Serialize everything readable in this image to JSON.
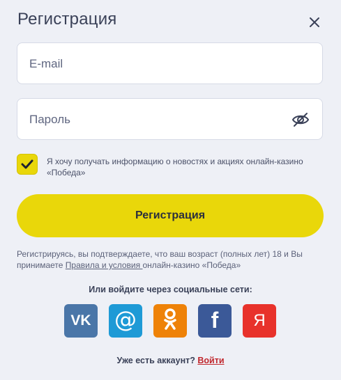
{
  "header": {
    "title": "Регистрация",
    "close_icon": "close-icon"
  },
  "form": {
    "email": {
      "placeholder": "E-mail",
      "value": ""
    },
    "password": {
      "placeholder": "Пароль",
      "value": "",
      "toggle_icon": "eye-off-icon"
    },
    "consent": {
      "checked": true,
      "text": "Я хочу получать информацию о новостях и акциях онлайн-казино «Победа»"
    },
    "submit_label": "Регистрация"
  },
  "legal": {
    "text_before": "Регистрируясь, вы подтверждаете, что ваш возраст (полных лет) 18 и Вы принимаете ",
    "link": "Правила и условия ",
    "text_after": "онлайн-казино «Победа»"
  },
  "social": {
    "title": "Или войдите через социальные сети:",
    "providers": [
      {
        "name": "vk",
        "icon": "vk-icon",
        "label": "VK",
        "color": "#4a76a8"
      },
      {
        "name": "mailru",
        "icon": "at-icon",
        "label": "@",
        "color": "#1e9ad6"
      },
      {
        "name": "odnoklassniki",
        "icon": "ok-icon",
        "color": "#ee8208"
      },
      {
        "name": "facebook",
        "icon": "facebook-icon",
        "label": "f",
        "color": "#3b5998"
      },
      {
        "name": "yandex",
        "icon": "yandex-icon",
        "label": "Я",
        "color": "#e8322b"
      }
    ]
  },
  "footer": {
    "question": "Уже есть аккаунт? ",
    "login_link": "Войти"
  },
  "colors": {
    "accent": "#e9d70a",
    "link_red": "#c0272d",
    "background": "#eef0f6"
  }
}
